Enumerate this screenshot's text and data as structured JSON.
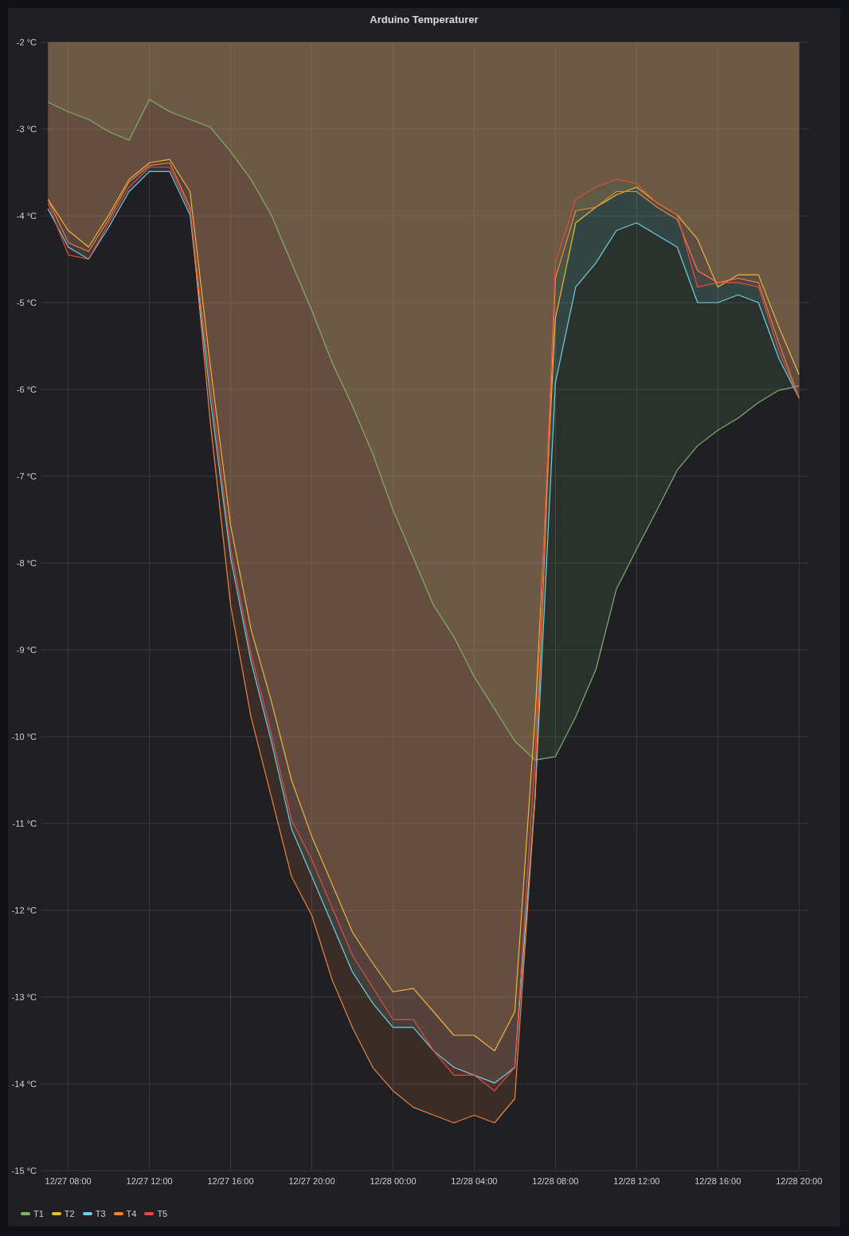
{
  "panel": {
    "title": "Arduino Temperaturer",
    "chart_data": {
      "type": "area",
      "categories": [
        null,
        "12/27 08:00",
        null,
        null,
        null,
        "12/27 12:00",
        null,
        null,
        null,
        "12/27 16:00",
        null,
        null,
        null,
        "12/27 20:00",
        null,
        null,
        null,
        "12/28 00:00",
        null,
        null,
        null,
        "12/28 04:00",
        null,
        null,
        null,
        "12/28 08:00",
        null,
        null,
        null,
        "12/28 12:00",
        null,
        null,
        null,
        "12/28 16:00",
        null,
        null,
        null,
        "12/28 20:00"
      ],
      "series": [
        {
          "name": "T1",
          "color": "#7eb26d",
          "values": [
            -2.69,
            -2.8,
            -2.89,
            -3.03,
            -3.13,
            -2.66,
            -2.8,
            -2.89,
            -2.98,
            -3.26,
            -3.58,
            -3.99,
            -4.54,
            -5.09,
            -5.69,
            -6.19,
            -6.74,
            -7.39,
            -7.94,
            -8.49,
            -8.85,
            -9.31,
            -9.68,
            -10.05,
            -10.27,
            -10.23,
            -9.77,
            -9.22,
            -8.3,
            -7.84,
            -7.39,
            -6.93,
            -6.65,
            -6.47,
            -6.33,
            -6.15,
            -6.01,
            -5.96
          ]
        },
        {
          "name": "T2",
          "color": "#eab839",
          "values": [
            -3.81,
            -4.17,
            -4.36,
            -3.99,
            -3.58,
            -3.39,
            -3.35,
            -3.72,
            -5.73,
            -7.57,
            -8.76,
            -9.59,
            -10.5,
            -11.15,
            -11.7,
            -12.25,
            -12.61,
            -12.94,
            -12.9,
            -13.17,
            -13.44,
            -13.44,
            -13.62,
            -13.17,
            -9.77,
            -5.18,
            -4.08,
            -3.9,
            -3.76,
            -3.67,
            -3.85,
            -3.99,
            -4.27,
            -4.82,
            -4.68,
            -4.68,
            -5.28,
            -5.83
          ]
        },
        {
          "name": "T3",
          "color": "#6ed0e0",
          "values": [
            -3.92,
            -4.36,
            -4.5,
            -4.13,
            -3.72,
            -3.49,
            -3.49,
            -3.99,
            -6.1,
            -7.94,
            -9.13,
            -10.05,
            -11.06,
            -11.61,
            -12.16,
            -12.71,
            -13.07,
            -13.35,
            -13.35,
            -13.62,
            -13.81,
            -13.9,
            -13.99,
            -13.81,
            -10.69,
            -5.92,
            -4.82,
            -4.54,
            -4.17,
            -4.08,
            -4.22,
            -4.36,
            -5.0,
            -5.0,
            -4.91,
            -5.0,
            -5.64,
            -6.1
          ]
        },
        {
          "name": "T4",
          "color": "#ef843c",
          "values": [
            -3.81,
            -4.31,
            -4.41,
            -4.04,
            -3.61,
            -3.42,
            -3.39,
            -3.9,
            -6.38,
            -8.49,
            -9.77,
            -10.69,
            -11.61,
            -12.06,
            -12.8,
            -13.35,
            -13.81,
            -14.08,
            -14.27,
            -14.36,
            -14.45,
            -14.36,
            -14.45,
            -14.17,
            -10.69,
            -4.72,
            -3.94,
            -3.9,
            -3.72,
            -3.72,
            -3.9,
            -4.04,
            -4.63,
            -4.77,
            -4.72,
            -4.77,
            -5.46,
            -6.1
          ]
        },
        {
          "name": "T5",
          "color": "#e24d42",
          "values": [
            -3.85,
            -4.45,
            -4.5,
            -4.08,
            -3.67,
            -3.44,
            -3.44,
            -3.94,
            -5.92,
            -7.84,
            -9.04,
            -9.96,
            -10.96,
            -11.42,
            -11.97,
            -12.52,
            -12.89,
            -13.26,
            -13.26,
            -13.62,
            -13.9,
            -13.9,
            -14.08,
            -13.81,
            -10.23,
            -4.54,
            -3.81,
            -3.67,
            -3.58,
            -3.63,
            -3.85,
            -3.99,
            -4.82,
            -4.77,
            -4.77,
            -4.82,
            -5.55,
            -6.1
          ]
        }
      ],
      "ylim": [
        -15,
        -2
      ],
      "grid": true,
      "yticks": [
        {
          "value": -2,
          "label": "-2 °C"
        },
        {
          "value": -3,
          "label": "-3 °C"
        },
        {
          "value": -4,
          "label": "-4 °C"
        },
        {
          "value": -5,
          "label": "-5 °C"
        },
        {
          "value": -6,
          "label": "-6 °C"
        },
        {
          "value": -7,
          "label": "-7 °C"
        },
        {
          "value": -8,
          "label": "-8 °C"
        },
        {
          "value": -9,
          "label": "-9 °C"
        },
        {
          "value": -10,
          "label": "-10 °C"
        },
        {
          "value": -11,
          "label": "-11 °C"
        },
        {
          "value": -12,
          "label": "-12 °C"
        },
        {
          "value": -13,
          "label": "-13 °C"
        },
        {
          "value": -14,
          "label": "-14 °C"
        },
        {
          "value": -15,
          "label": "-15 °C"
        }
      ]
    }
  }
}
